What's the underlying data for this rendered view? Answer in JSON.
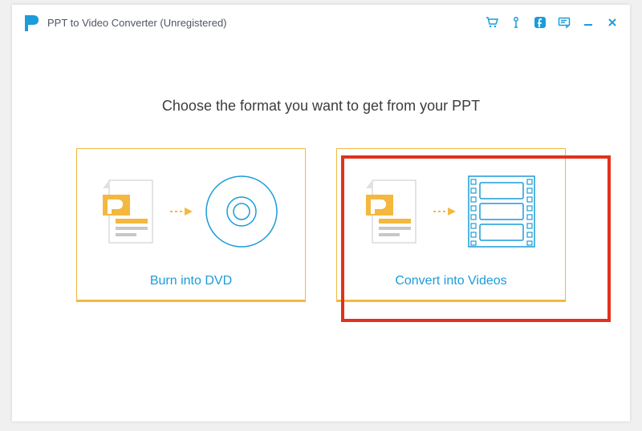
{
  "titlebar": {
    "app_title": "PPT to Video Converter (Unregistered)"
  },
  "main": {
    "heading": "Choose the format you want to get from your PPT",
    "options": [
      {
        "label": "Burn into DVD"
      },
      {
        "label": "Convert into Videos"
      }
    ]
  },
  "colors": {
    "accent_blue": "#1c9cd9",
    "accent_yellow": "#f4b83f",
    "highlight_red": "#e1321c"
  }
}
